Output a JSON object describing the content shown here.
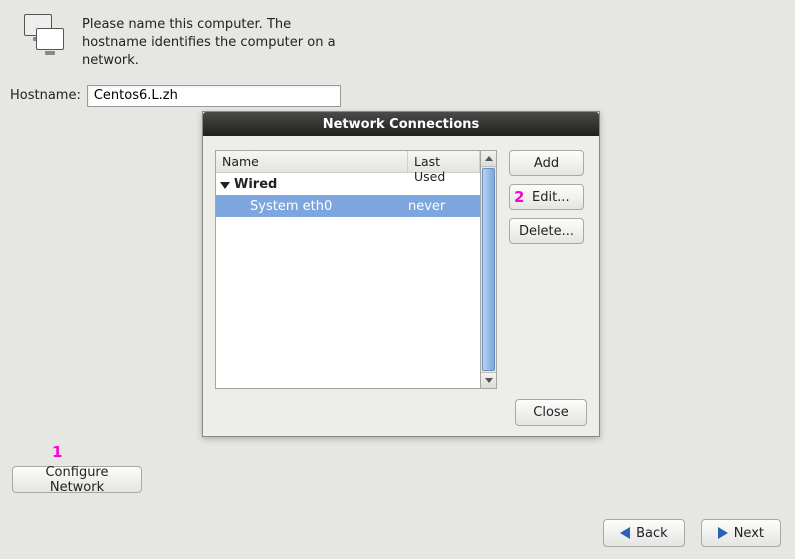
{
  "header": {
    "description": "Please name this computer.  The hostname identifies the computer on a network."
  },
  "hostname": {
    "label": "Hostname:",
    "value": "Centos6.L.zh"
  },
  "configure_button": "Configure Network",
  "nav": {
    "back": "Back",
    "next": "Next"
  },
  "annotations": {
    "one": "1",
    "two": "2"
  },
  "dialog": {
    "title": "Network Connections",
    "columns": {
      "name": "Name",
      "last": "Last Used"
    },
    "group": "Wired",
    "connection": {
      "name": "System eth0",
      "last": "never"
    },
    "buttons": {
      "add": "Add",
      "edit": "Edit...",
      "delete": "Delete...",
      "close": "Close"
    }
  }
}
